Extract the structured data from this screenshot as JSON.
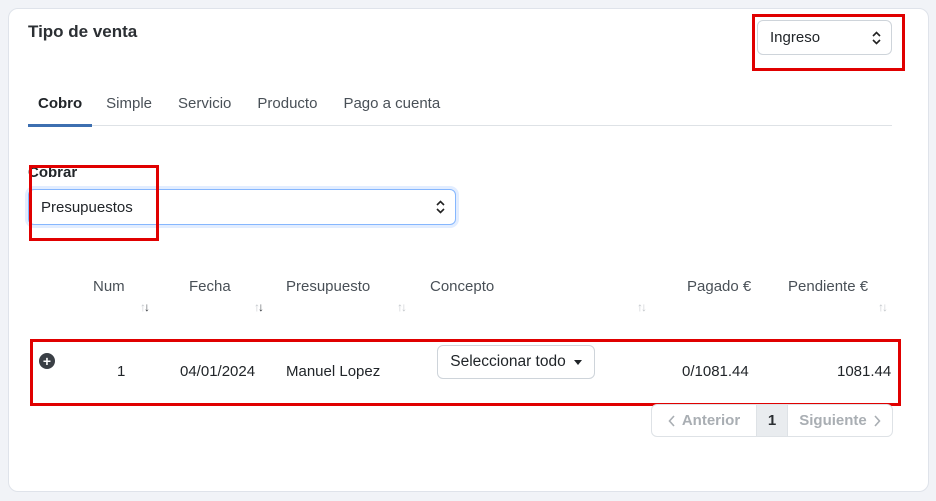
{
  "card": {
    "title": "Tipo de venta"
  },
  "tipo_select": {
    "value": "Ingreso"
  },
  "tabs": [
    {
      "label": "Cobro",
      "active": true
    },
    {
      "label": "Simple"
    },
    {
      "label": "Servicio"
    },
    {
      "label": "Producto"
    },
    {
      "label": "Pago a cuenta"
    }
  ],
  "cobrar": {
    "label": "Cobrar",
    "value": "Presupuestos"
  },
  "table": {
    "headers": [
      "Num",
      "Fecha",
      "Presupuesto",
      "Concepto",
      "Pagado €",
      "Pendiente €"
    ],
    "rows": [
      {
        "num": "1",
        "fecha": "04/01/2024",
        "presupuesto": "Manuel Lopez",
        "concepto": "Seleccionar todo",
        "pagado": "0/1081.44",
        "pendiente": "1081.44"
      }
    ]
  },
  "pagination": {
    "prev": "Anterior",
    "page": "1",
    "next": "Siguiente"
  },
  "colors": {
    "highlight": "#e00000",
    "tab_active": "#3d6fb0"
  }
}
